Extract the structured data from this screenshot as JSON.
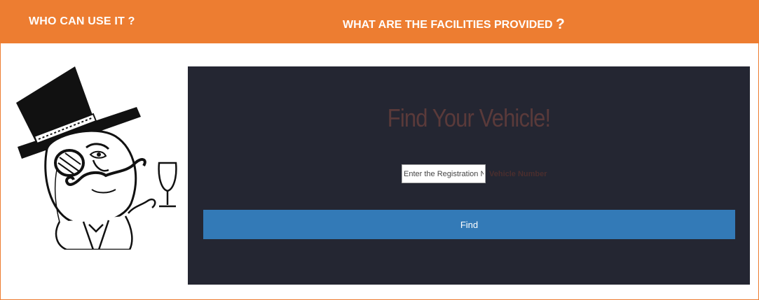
{
  "header": {
    "left_title": "WHO CAN USE IT ?",
    "right_title_text": "WHAT ARE  THE FACILITIES PROVIDED ",
    "right_title_qmark": "?",
    "background_color": "#ed7d31"
  },
  "illustration": {
    "icon": "gentleman-meme-icon"
  },
  "panel": {
    "background_color": "#242632",
    "title": "Find Your Vehicle!",
    "registration_placeholder": "Enter the Registration No.",
    "registration_value": "",
    "registration_label": "Vehicle Number",
    "find_button_label": "Find",
    "find_button_color": "#337ab7"
  }
}
